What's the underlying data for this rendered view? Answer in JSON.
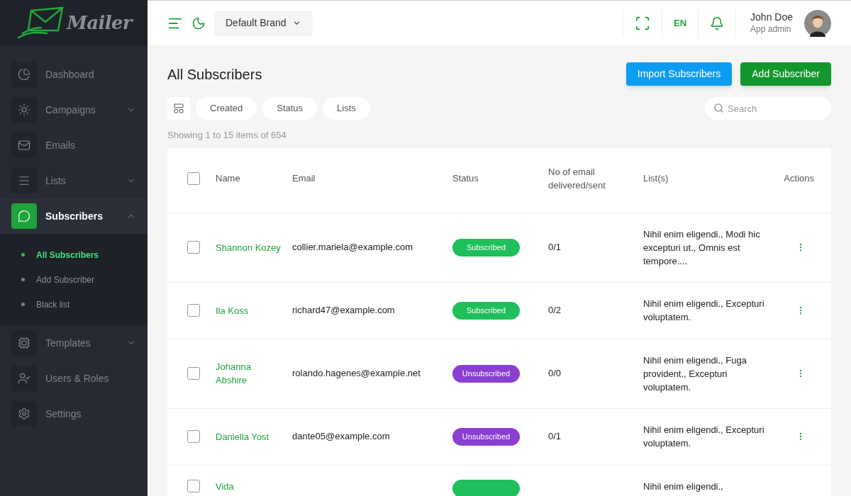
{
  "logo": {
    "text": "Mailer"
  },
  "sidebar": {
    "items": [
      {
        "label": "Dashboard",
        "selected": false
      },
      {
        "label": "Campaigns",
        "selected": false,
        "expanded": false
      },
      {
        "label": "Emails",
        "selected": false
      },
      {
        "label": "Lists",
        "selected": false,
        "expanded": false
      },
      {
        "label": "Subscribers",
        "selected": true,
        "expanded": true,
        "children": [
          {
            "label": "All Subscribers",
            "selected": true
          },
          {
            "label": "Add Subscriber",
            "selected": false
          },
          {
            "label": "Black list",
            "selected": false
          }
        ]
      },
      {
        "label": "Templates",
        "selected": false,
        "expanded": false
      },
      {
        "label": "Users & Roles",
        "selected": false
      },
      {
        "label": "Settings",
        "selected": false
      }
    ]
  },
  "topbar": {
    "brand": "Default Brand",
    "language": "EN",
    "user": {
      "name": "John Doe",
      "role": "App admin"
    }
  },
  "page": {
    "title": "All Subscribers",
    "buttons": [
      {
        "label": "Import Subscribers",
        "kind": "secondary"
      },
      {
        "label": "Add Subscriber",
        "kind": "primary"
      }
    ],
    "filters": [
      "Created",
      "Status",
      "Lists"
    ],
    "search": {
      "placeholder": "Search"
    },
    "summary": "Showing 1 to 15 items of 654"
  },
  "table": {
    "all_checked": false,
    "columns": [
      "Name",
      "Email",
      "Status",
      "No of email delivered/sent",
      "List(s)",
      "Actions"
    ],
    "rows": [
      {
        "name": "Shannon Kozey",
        "email": "collier.mariela@example.com",
        "status": {
          "kind": "subscribed",
          "label": "Subscribed"
        },
        "count": "0/1",
        "lists": "Nihil enim eligendi., Modi hic excepturi ut., Omnis est tempore....",
        "checked": false
      },
      {
        "name": "Ila Koss",
        "email": "richard47@example.com",
        "status": {
          "kind": "subscribed",
          "label": "Subscribed"
        },
        "count": "0/2",
        "lists": "Nihil enim eligendi., Excepturi voluptatem.",
        "checked": false
      },
      {
        "name": "Johanna Abshire",
        "email": "rolando.hagenes@example.net",
        "status": {
          "kind": "unsubscribed",
          "label": "Unsubscribed"
        },
        "count": "0/0",
        "lists": "Nihil enim eligendi., Fuga provident., Excepturi voluptatem.",
        "checked": false
      },
      {
        "name": "Daniella Yost",
        "email": "dante05@example.com",
        "status": {
          "kind": "unsubscribed",
          "label": "Unsubscribed"
        },
        "count": "0/1",
        "lists": "Nihil enim eligendi., Excepturi voluptatem.",
        "checked": false
      },
      {
        "name": "Vida",
        "status": {
          "kind": "subscribed"
        },
        "lists": "Nihil enim eligendi.,",
        "checked": false
      }
    ]
  }
}
